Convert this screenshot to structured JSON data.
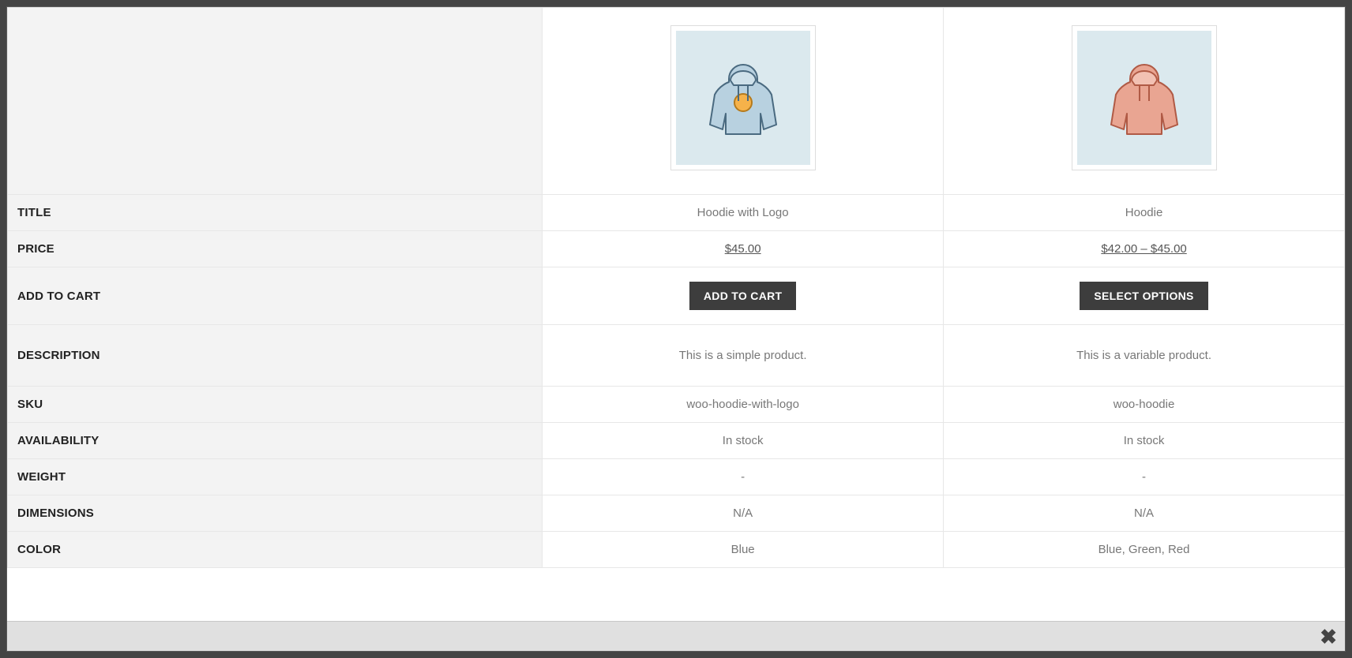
{
  "rows": {
    "title": "Title",
    "price": "Price",
    "add_to_cart": "Add to Cart",
    "description": "Description",
    "sku": "SKU",
    "availability": "Availability",
    "weight": "Weight",
    "dimensions": "Dimensions",
    "color": "Color"
  },
  "products": [
    {
      "image_tint": "blue",
      "title": "Hoodie with Logo",
      "price": "$45.00",
      "cart_button": "Add to Cart",
      "description": "This is a simple product.",
      "sku": "woo-hoodie-with-logo",
      "availability": "In stock",
      "weight": "-",
      "dimensions": "N/A",
      "color": "Blue"
    },
    {
      "image_tint": "red",
      "title": "Hoodie",
      "price": "$42.00 – $45.00",
      "cart_button": "Select Options",
      "description": "This is a variable product.",
      "sku": "woo-hoodie",
      "availability": "In stock",
      "weight": "-",
      "dimensions": "N/A",
      "color": "Blue, Green, Red"
    }
  ]
}
